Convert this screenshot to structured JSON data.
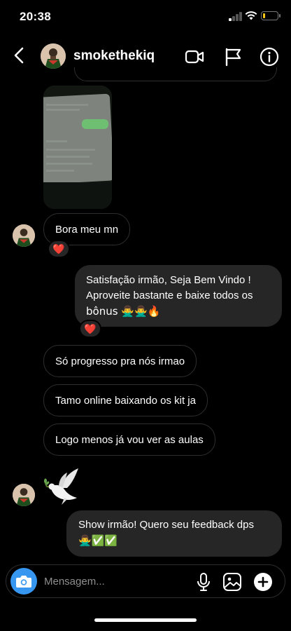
{
  "status_bar": {
    "time": "20:38",
    "battery_level": 0.2,
    "battery_color": "#f5c518"
  },
  "header": {
    "username": "smokethekiq",
    "icons": [
      "back-icon",
      "video-call-icon",
      "flag-icon",
      "info-icon"
    ]
  },
  "messages": [
    {
      "type": "image",
      "direction": "incoming"
    },
    {
      "type": "text",
      "direction": "incoming",
      "text": "Bora meu mn",
      "reaction": "❤️"
    },
    {
      "type": "text",
      "direction": "outgoing",
      "lines": [
        "Satisfação irmão, Seja Bem Vindo !",
        "Aproveite bastante e baixe todos os",
        "bônus 🙅‍♂️🙅‍♂️🔥"
      ],
      "reaction": "❤️"
    },
    {
      "type": "text",
      "direction": "incoming",
      "text": "Só progresso pra nós irmao"
    },
    {
      "type": "text",
      "direction": "incoming",
      "text": "Tamo online baixando os kit ja"
    },
    {
      "type": "text",
      "direction": "incoming",
      "text": "Logo menos já vou ver as aulas"
    },
    {
      "type": "sticker",
      "direction": "incoming",
      "emoji": "🕊️"
    },
    {
      "type": "text",
      "direction": "outgoing",
      "lines": [
        "Show irmão! Quero seu feedback dps",
        "🙅‍♂️✅✅"
      ]
    }
  ],
  "composer": {
    "placeholder": "Mensagem...",
    "icons": [
      "camera-icon",
      "microphone-icon",
      "gallery-icon",
      "plus-icon"
    ]
  },
  "colors": {
    "accent": "#3797f0",
    "bubble_out": "#262626",
    "reaction_heart": "#e0245e"
  }
}
